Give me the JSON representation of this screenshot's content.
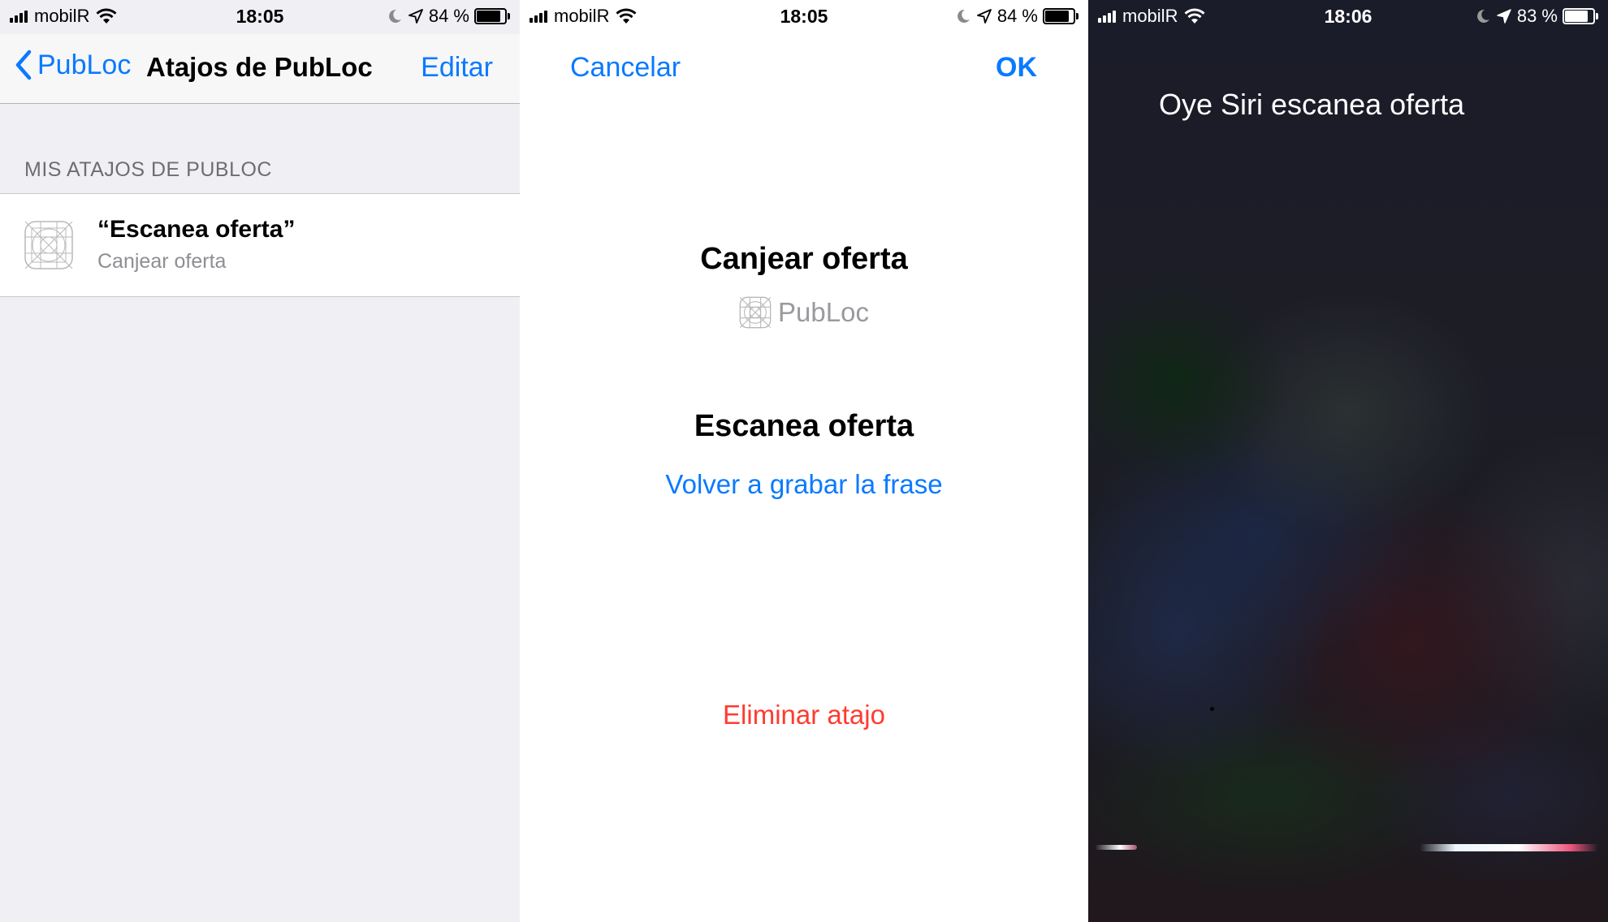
{
  "screens": [
    {
      "status": {
        "carrier": "mobilR",
        "time": "18:05",
        "battery": "84 %",
        "battery_level": 0.84
      },
      "nav": {
        "back_label": "PubLoc",
        "title": "Atajos de PubLoc",
        "edit_label": "Editar"
      },
      "section_header": "MIS ATAJOS DE PUBLOC",
      "shortcut": {
        "phrase": "“Escanea oferta”",
        "action": "Canjear oferta",
        "icon": "app-placeholder-icon"
      }
    },
    {
      "status": {
        "carrier": "mobilR",
        "time": "18:05",
        "battery": "84 %",
        "battery_level": 0.84
      },
      "cancel_label": "Cancelar",
      "ok_label": "OK",
      "action_title": "Canjear oferta",
      "app_name": "PubLoc",
      "phrase_title": "Escanea oferta",
      "rerecord_label": "Volver a grabar la frase",
      "delete_label": "Eliminar atajo"
    },
    {
      "status": {
        "carrier": "mobilR",
        "time": "18:06",
        "battery": "83 %",
        "battery_level": 0.83
      },
      "transcript": "Oye Siri escanea oferta"
    }
  ],
  "colors": {
    "ios_blue": "#0a7aff",
    "destructive_red": "#ff3b30",
    "group_background": "#efeff4",
    "secondary_text": "#8e8e93"
  }
}
